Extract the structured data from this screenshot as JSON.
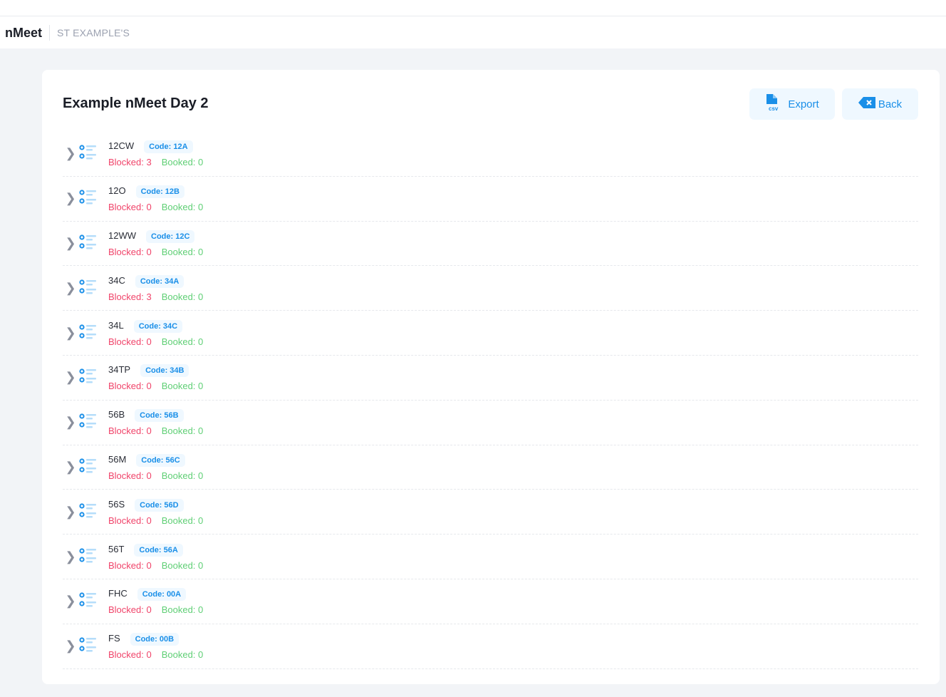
{
  "nav": {
    "brand": "nMeet",
    "org": "ST EXAMPLE'S"
  },
  "page": {
    "title": "Example nMeet Day 2",
    "export_label": "Export",
    "back_label": "Back"
  },
  "labels": {
    "blocked": "Blocked: ",
    "booked": "Booked: "
  },
  "rows": [
    {
      "name": "12CW",
      "code": "Code: 12A",
      "blocked": "3",
      "booked": "0"
    },
    {
      "name": "12O",
      "code": "Code: 12B",
      "blocked": "0",
      "booked": "0"
    },
    {
      "name": "12WW",
      "code": "Code: 12C",
      "blocked": "0",
      "booked": "0"
    },
    {
      "name": "34C",
      "code": "Code: 34A",
      "blocked": "3",
      "booked": "0"
    },
    {
      "name": "34L",
      "code": "Code: 34C",
      "blocked": "0",
      "booked": "0"
    },
    {
      "name": "34TP",
      "code": "Code: 34B",
      "blocked": "0",
      "booked": "0"
    },
    {
      "name": "56B",
      "code": "Code: 56B",
      "blocked": "0",
      "booked": "0"
    },
    {
      "name": "56M",
      "code": "Code: 56C",
      "blocked": "0",
      "booked": "0"
    },
    {
      "name": "56S",
      "code": "Code: 56D",
      "blocked": "0",
      "booked": "0"
    },
    {
      "name": "56T",
      "code": "Code: 56A",
      "blocked": "0",
      "booked": "0"
    },
    {
      "name": "FHC",
      "code": "Code: 00A",
      "blocked": "0",
      "booked": "0"
    },
    {
      "name": "FS",
      "code": "Code: 00B",
      "blocked": "0",
      "booked": "0"
    }
  ]
}
